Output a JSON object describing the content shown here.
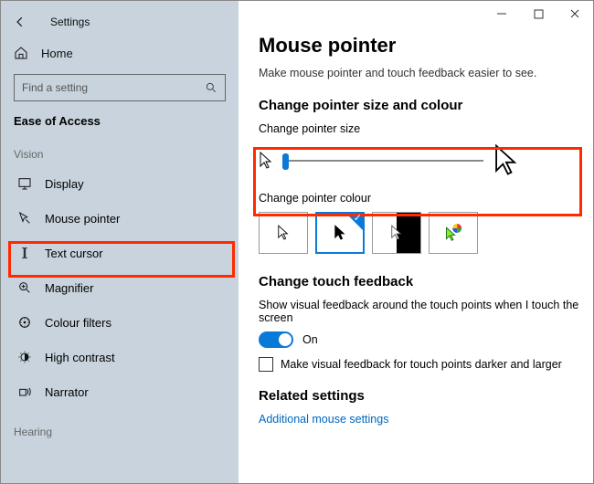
{
  "window": {
    "title": "Settings"
  },
  "sidebar": {
    "home": "Home",
    "search_placeholder": "Find a setting",
    "category": "Ease of Access",
    "group_vision": "Vision",
    "group_hearing": "Hearing",
    "items": [
      {
        "label": "Display"
      },
      {
        "label": "Mouse pointer"
      },
      {
        "label": "Text cursor"
      },
      {
        "label": "Magnifier"
      },
      {
        "label": "Colour filters"
      },
      {
        "label": "High contrast"
      },
      {
        "label": "Narrator"
      }
    ]
  },
  "main": {
    "title": "Mouse pointer",
    "description": "Make mouse pointer and touch feedback easier to see.",
    "section_size_colour": "Change pointer size and colour",
    "size_label": "Change pointer size",
    "colour_label": "Change pointer colour",
    "section_touch": "Change touch feedback",
    "touch_desc": "Show visual feedback around the touch points when I touch the screen",
    "toggle_on": "On",
    "chk_label": "Make visual feedback for touch points darker and larger",
    "section_related": "Related settings",
    "link_additional": "Additional mouse settings"
  }
}
